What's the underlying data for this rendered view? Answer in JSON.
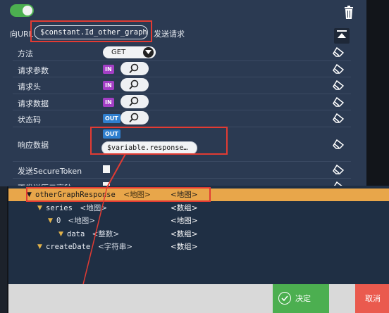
{
  "request": {
    "url_label": "向URL",
    "url_value": "$constant.Id_other_graph",
    "url_suffix": "发送请求"
  },
  "rows": [
    {
      "label": "方法",
      "kind": "dropdown",
      "value": "GET"
    },
    {
      "label": "请求参数",
      "kind": "in"
    },
    {
      "label": "请求头",
      "kind": "in"
    },
    {
      "label": "请求数据",
      "kind": "in"
    },
    {
      "label": "状态码",
      "kind": "out"
    },
    {
      "label": "响应数据",
      "kind": "out-field",
      "value": "$variable.response…"
    },
    {
      "label": "发送SecureToken",
      "kind": "checkbox"
    },
    {
      "label": "不发送历元毫秒",
      "kind": "checkbox"
    }
  ],
  "tags": {
    "in": "IN",
    "out": "OUT"
  },
  "tree": [
    {
      "name": "otherGraphResponse",
      "type": "<地图>",
      "col": "<地图>",
      "depth": 0,
      "selected": true
    },
    {
      "name": "series",
      "type": "<地图>",
      "col": "<数组>",
      "depth": 1,
      "selected": false
    },
    {
      "name": "0",
      "type": "<地图>",
      "col": "<地图>",
      "depth": 2,
      "selected": false
    },
    {
      "name": "data",
      "type": "<整数>",
      "col": "<数组>",
      "depth": 3,
      "selected": false
    },
    {
      "name": "createDate",
      "type": "<字符串>",
      "col": "<数组>",
      "depth": 1,
      "selected": false
    }
  ],
  "footer": {
    "confirm_label": "决定",
    "cancel_label": "取消"
  },
  "colors": {
    "accent_green": "#4caf50",
    "highlight": "#e23b33",
    "tag_in": "#a33fc4",
    "tag_out": "#2f7fcf",
    "selected_row": "#e8a64a"
  }
}
